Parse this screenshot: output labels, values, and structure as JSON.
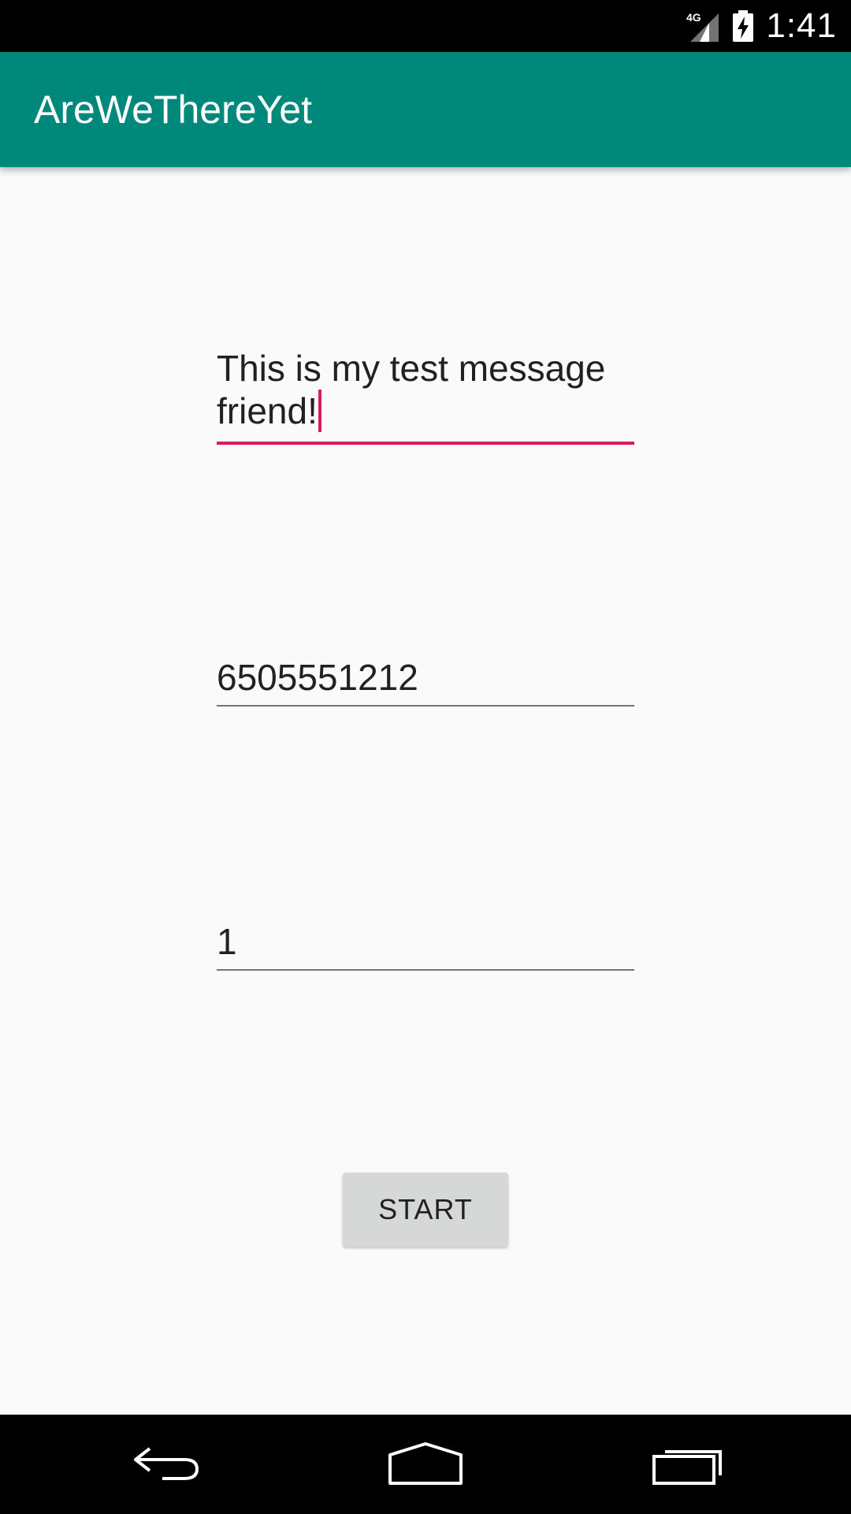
{
  "status_bar": {
    "network_label": "4G",
    "time": "1:41",
    "icons": [
      "signal-4g-icon",
      "battery-charging-icon"
    ]
  },
  "app_bar": {
    "title": "AreWeThereYet",
    "color": "#00897b"
  },
  "form": {
    "message_value": "This is my test message friend!",
    "phone_value": "6505551212",
    "count_value": "1",
    "start_label": "START",
    "focus_accent_color": "#d81b60"
  },
  "nav_bar": {
    "icons": [
      "back-icon",
      "home-icon",
      "recents-icon"
    ]
  }
}
